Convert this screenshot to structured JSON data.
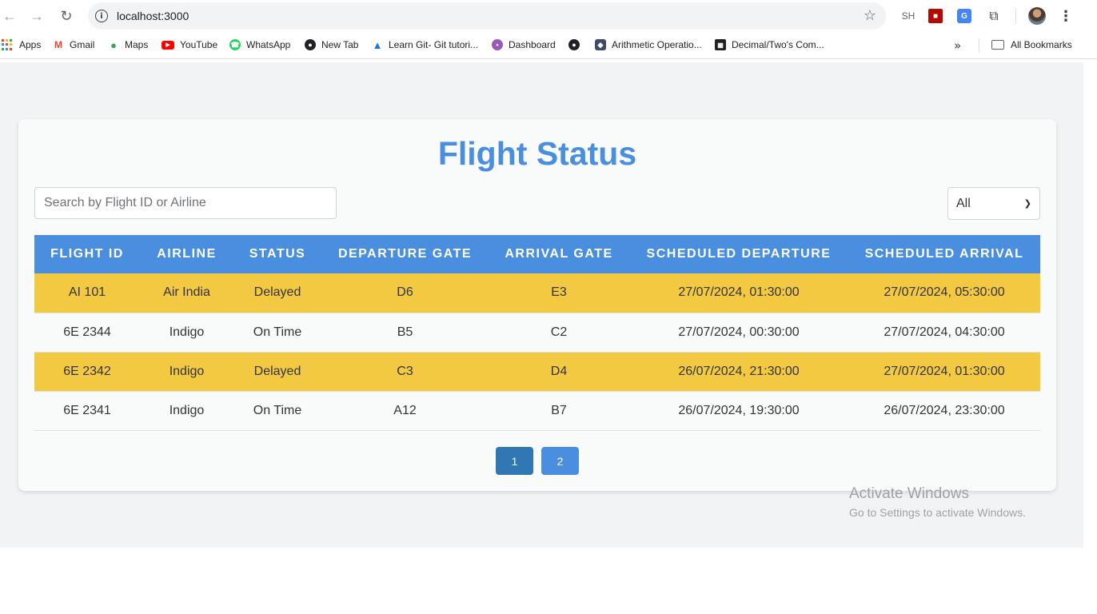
{
  "browser": {
    "url": "localhost:3000",
    "extensions": {
      "sh_label": "SH"
    },
    "bookmarks": [
      {
        "label": "Apps"
      },
      {
        "label": "Gmail"
      },
      {
        "label": "Maps"
      },
      {
        "label": "YouTube"
      },
      {
        "label": "WhatsApp"
      },
      {
        "label": "New Tab"
      },
      {
        "label": "Learn Git- Git tutori..."
      },
      {
        "label": "Dashboard"
      },
      {
        "label": ""
      },
      {
        "label": "Arithmetic Operatio..."
      },
      {
        "label": "Decimal/Two's Com..."
      }
    ],
    "all_bookmarks_label": "All Bookmarks"
  },
  "page": {
    "title": "Flight Status",
    "search": {
      "placeholder": "Search by Flight ID or Airline",
      "value": ""
    },
    "filter": {
      "selected": "All"
    },
    "table": {
      "headers": [
        "Flight ID",
        "Airline",
        "Status",
        "Departure Gate",
        "Arrival Gate",
        "Scheduled Departure",
        "Scheduled Arrival"
      ],
      "rows": [
        {
          "flight_id": "AI 101",
          "airline": "Air India",
          "status": "Delayed",
          "departure_gate": "D6",
          "arrival_gate": "E3",
          "scheduled_departure": "27/07/2024, 01:30:00",
          "scheduled_arrival": "27/07/2024, 05:30:00"
        },
        {
          "flight_id": "6E 2344",
          "airline": "Indigo",
          "status": "On Time",
          "departure_gate": "B5",
          "arrival_gate": "C2",
          "scheduled_departure": "27/07/2024, 00:30:00",
          "scheduled_arrival": "27/07/2024, 04:30:00"
        },
        {
          "flight_id": "6E 2342",
          "airline": "Indigo",
          "status": "Delayed",
          "departure_gate": "C3",
          "arrival_gate": "D4",
          "scheduled_departure": "26/07/2024, 21:30:00",
          "scheduled_arrival": "27/07/2024, 01:30:00"
        },
        {
          "flight_id": "6E 2341",
          "airline": "Indigo",
          "status": "On Time",
          "departure_gate": "A12",
          "arrival_gate": "B7",
          "scheduled_departure": "26/07/2024, 19:30:00",
          "scheduled_arrival": "26/07/2024, 23:30:00"
        }
      ]
    },
    "pagination": {
      "pages": [
        "1",
        "2"
      ],
      "current": "1"
    }
  },
  "watermark": {
    "title": "Activate Windows",
    "subtitle": "Go to Settings to activate Windows."
  },
  "colors": {
    "accent": "#4a8fdf",
    "delayed_row": "#f2c940",
    "active_page": "#2f78b4"
  }
}
